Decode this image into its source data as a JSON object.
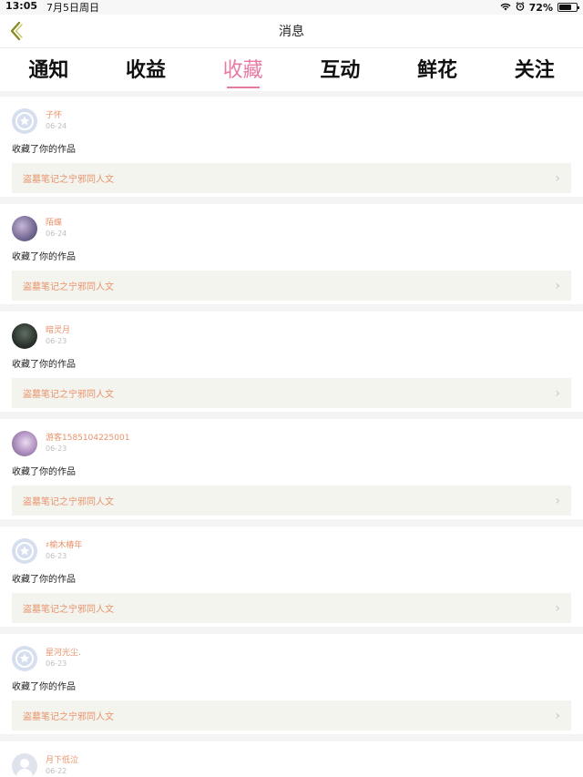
{
  "status_bar": {
    "time": "13:05",
    "date": "7月5日周日",
    "battery": "72%",
    "battery_level": 0.72
  },
  "nav": {
    "title": "消息",
    "accent_color": "#e87aa6"
  },
  "tabs": [
    {
      "label": "通知"
    },
    {
      "label": "收益"
    },
    {
      "label": "收藏",
      "active": true
    },
    {
      "label": "互动"
    },
    {
      "label": "鲜花"
    },
    {
      "label": "关注"
    }
  ],
  "items": [
    {
      "name": "子怀",
      "date": "06-24",
      "action": "收藏了你的作品",
      "work": "盗墓笔记之宁邪同人文",
      "avatar": "default"
    },
    {
      "name": "陌蝶",
      "date": "06-24",
      "action": "收藏了你的作品",
      "work": "盗墓笔记之宁邪同人文",
      "avatar": "img1"
    },
    {
      "name": "暗灵月",
      "date": "06-23",
      "action": "收藏了你的作品",
      "work": "盗墓笔记之宁邪同人文",
      "avatar": "img2"
    },
    {
      "name": "游客1585104225001",
      "date": "06-23",
      "action": "收藏了你的作品",
      "work": "盗墓笔记之宁邪同人文",
      "avatar": "img3"
    },
    {
      "name": "♯榆木椿年",
      "date": "06-23",
      "action": "收藏了你的作品",
      "work": "盗墓笔记之宁邪同人文",
      "avatar": "default"
    },
    {
      "name": "星河光尘.",
      "date": "06-23",
      "action": "收藏了你的作品",
      "work": "盗墓笔记之宁邪同人文",
      "avatar": "default"
    },
    {
      "name": "月下低泣",
      "date": "06-22",
      "avatar": "plain"
    }
  ]
}
